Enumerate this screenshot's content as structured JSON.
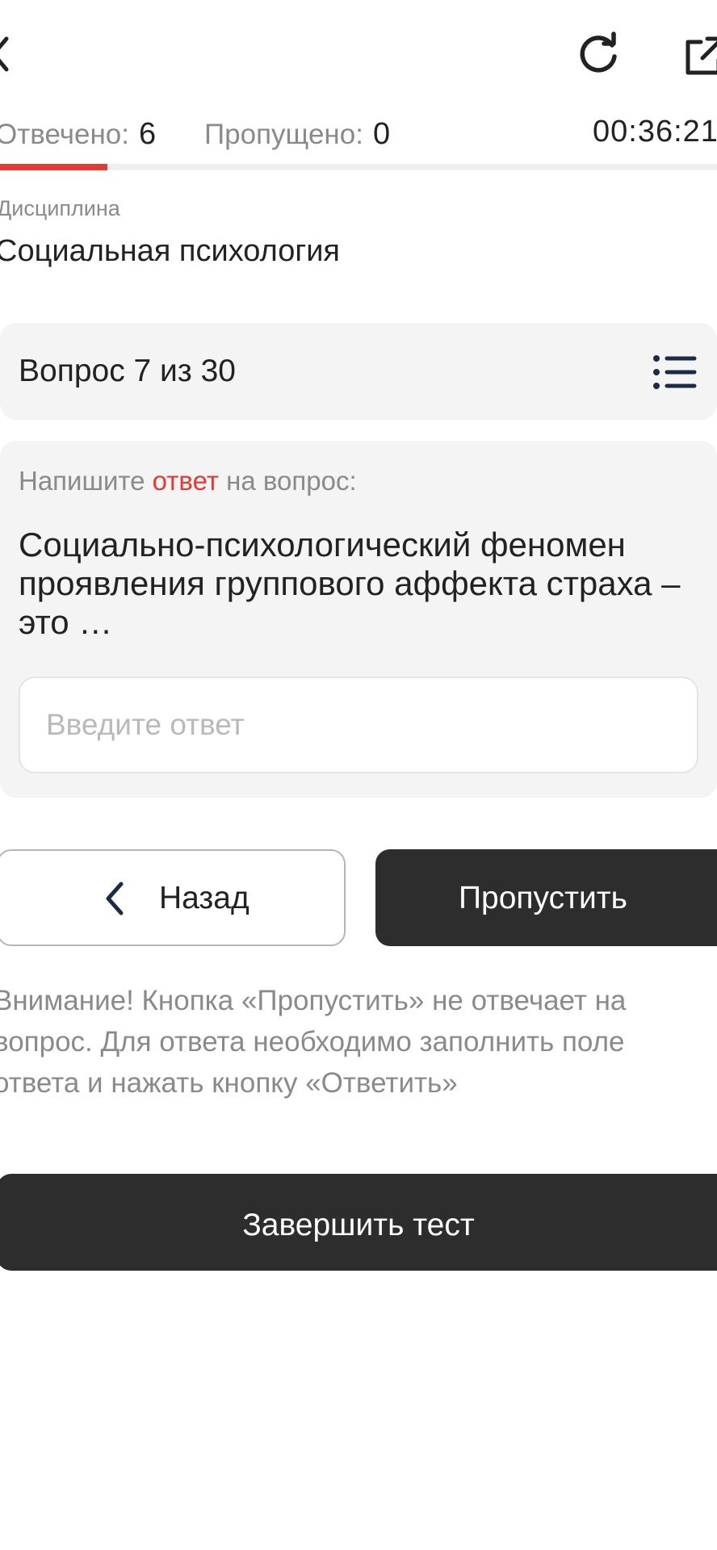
{
  "colors": {
    "accent": "#e53935",
    "dark_button": "#2d2d2d",
    "card_bg": "#f4f4f4",
    "muted_text": "#8a8a8a"
  },
  "toolbar": {
    "back_icon": "chevron-left-icon",
    "refresh_icon": "refresh-icon",
    "external_icon": "external-link-icon"
  },
  "stats": {
    "answered_label": "Отвечено:",
    "answered_value": "6",
    "skipped_label": "Пропущено:",
    "skipped_value": "0",
    "timer": "00:36:21"
  },
  "progress": {
    "answered": 6,
    "total": 30
  },
  "discipline": {
    "label": "Дисциплина",
    "value": "Социальная психология"
  },
  "question": {
    "counter": "Вопрос 7 из 30",
    "instruction_before": "Напишите ",
    "instruction_accent": "ответ",
    "instruction_after": " на вопрос:",
    "text": "Социально-психологический феномен проявления группового аффекта страха – это …",
    "input_placeholder": "Введите ответ",
    "input_value": ""
  },
  "buttons": {
    "back_label": "Назад",
    "skip_label": "Пропустить",
    "finish_label": "Завершить тест"
  },
  "warning": "Внимание! Кнопка «Пропустить» не отвечает на вопрос. Для ответа необходимо заполнить поле ответа и нажать кнопку «Ответить»"
}
